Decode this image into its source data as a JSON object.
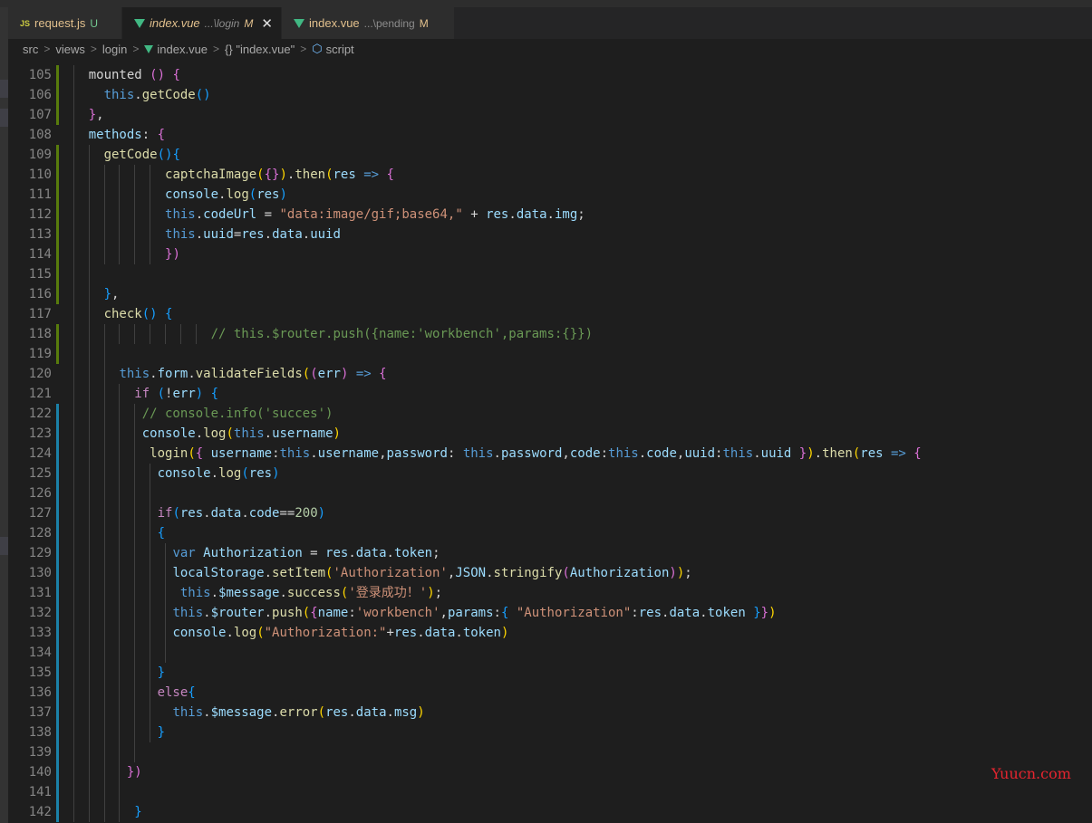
{
  "tabs": [
    {
      "icon": "JS",
      "name": "request.js",
      "path": "",
      "status": "U",
      "active": false
    },
    {
      "icon": "vue",
      "name": "index.vue",
      "path": "...\\login",
      "status": "M",
      "active": true
    },
    {
      "icon": "vue",
      "name": "index.vue",
      "path": "...\\pending",
      "status": "M",
      "active": false
    }
  ],
  "breadcrumb": [
    "src",
    "views",
    "login",
    "index.vue",
    "{} \"index.vue\"",
    "script"
  ],
  "watermark": "Yuucn.com",
  "lines": [
    {
      "n": "105",
      "g": "#587c0c",
      "x": [
        [
          "    ",
          "p"
        ],
        [
          "mounted",
          "p"
        ],
        [
          " ",
          "p"
        ],
        [
          "()",
          "b2"
        ],
        [
          " ",
          "p"
        ],
        [
          "{",
          "b2"
        ]
      ]
    },
    {
      "n": "106",
      "g": "#587c0c",
      "x": [
        [
          "      ",
          "p"
        ],
        [
          "this",
          "k"
        ],
        [
          ".",
          "p"
        ],
        [
          "getCode",
          "f"
        ],
        [
          "()",
          "b3"
        ]
      ]
    },
    {
      "n": "107",
      "g": "#587c0c",
      "x": [
        [
          "    ",
          "p"
        ],
        [
          "}",
          "b2"
        ],
        [
          ",",
          "p"
        ]
      ]
    },
    {
      "n": "108",
      "g": "",
      "x": [
        [
          "    ",
          "p"
        ],
        [
          "methods",
          "v"
        ],
        [
          ": ",
          "p"
        ],
        [
          "{",
          "b2"
        ]
      ]
    },
    {
      "n": "109",
      "g": "#587c0c",
      "x": [
        [
          "      ",
          "p"
        ],
        [
          "getCode",
          "f"
        ],
        [
          "()",
          "b3"
        ],
        [
          "{",
          "b3"
        ]
      ]
    },
    {
      "n": "110",
      "g": "#587c0c",
      "x": [
        [
          "              ",
          "p"
        ],
        [
          "captchaImage",
          "f"
        ],
        [
          "(",
          "b1"
        ],
        [
          "{}",
          "b2"
        ],
        [
          ")",
          "b1"
        ],
        [
          ".",
          "p"
        ],
        [
          "then",
          "f"
        ],
        [
          "(",
          "b1"
        ],
        [
          "res",
          "v"
        ],
        [
          " ",
          "p"
        ],
        [
          "=>",
          "k"
        ],
        [
          " ",
          "p"
        ],
        [
          "{",
          "b2"
        ]
      ]
    },
    {
      "n": "111",
      "g": "#587c0c",
      "x": [
        [
          "              ",
          "p"
        ],
        [
          "console",
          "v"
        ],
        [
          ".",
          "p"
        ],
        [
          "log",
          "f"
        ],
        [
          "(",
          "b3"
        ],
        [
          "res",
          "v"
        ],
        [
          ")",
          "b3"
        ]
      ]
    },
    {
      "n": "112",
      "g": "#587c0c",
      "x": [
        [
          "              ",
          "p"
        ],
        [
          "this",
          "k"
        ],
        [
          ".",
          "p"
        ],
        [
          "codeUrl",
          "v"
        ],
        [
          " = ",
          "p"
        ],
        [
          "\"data:image/gif;base64,\"",
          "s"
        ],
        [
          " + ",
          "p"
        ],
        [
          "res",
          "v"
        ],
        [
          ".",
          "p"
        ],
        [
          "data",
          "v"
        ],
        [
          ".",
          "p"
        ],
        [
          "img",
          "v"
        ],
        [
          ";",
          "p"
        ]
      ]
    },
    {
      "n": "113",
      "g": "#587c0c",
      "x": [
        [
          "              ",
          "p"
        ],
        [
          "this",
          "k"
        ],
        [
          ".",
          "p"
        ],
        [
          "uuid",
          "v"
        ],
        [
          "=",
          "p"
        ],
        [
          "res",
          "v"
        ],
        [
          ".",
          "p"
        ],
        [
          "data",
          "v"
        ],
        [
          ".",
          "p"
        ],
        [
          "uuid",
          "v"
        ]
      ]
    },
    {
      "n": "114",
      "g": "#587c0c",
      "x": [
        [
          "              ",
          "p"
        ],
        [
          "})",
          "b2"
        ]
      ]
    },
    {
      "n": "115",
      "g": "#587c0c",
      "x": []
    },
    {
      "n": "116",
      "g": "#587c0c",
      "x": [
        [
          "      ",
          "p"
        ],
        [
          "}",
          "b3"
        ],
        [
          ",",
          "p"
        ]
      ]
    },
    {
      "n": "117",
      "g": "",
      "x": [
        [
          "      ",
          "p"
        ],
        [
          "check",
          "f"
        ],
        [
          "()",
          "b3"
        ],
        [
          " ",
          "p"
        ],
        [
          "{",
          "b3"
        ]
      ]
    },
    {
      "n": "118",
      "g": "#587c0c",
      "x": [
        [
          "                    ",
          "p"
        ],
        [
          "// this.$router.push({name:'workbench',params:{}})",
          "c"
        ]
      ]
    },
    {
      "n": "119",
      "g": "#587c0c",
      "x": []
    },
    {
      "n": "120",
      "g": "",
      "x": [
        [
          "        ",
          "p"
        ],
        [
          "this",
          "k"
        ],
        [
          ".",
          "p"
        ],
        [
          "form",
          "v"
        ],
        [
          ".",
          "p"
        ],
        [
          "validateFields",
          "f"
        ],
        [
          "(",
          "b1"
        ],
        [
          "(",
          "b2"
        ],
        [
          "err",
          "v"
        ],
        [
          ")",
          "b2"
        ],
        [
          " ",
          "p"
        ],
        [
          "=>",
          "k"
        ],
        [
          " ",
          "p"
        ],
        [
          "{",
          "b2"
        ]
      ]
    },
    {
      "n": "121",
      "g": "",
      "x": [
        [
          "          ",
          "p"
        ],
        [
          "if",
          "kc"
        ],
        [
          " ",
          "p"
        ],
        [
          "(",
          "b3"
        ],
        [
          "!",
          "p"
        ],
        [
          "err",
          "v"
        ],
        [
          ")",
          "b3"
        ],
        [
          " ",
          "p"
        ],
        [
          "{",
          "b3"
        ]
      ]
    },
    {
      "n": "122",
      "g": "#1b81a8",
      "x": [
        [
          "           ",
          "p"
        ],
        [
          "// console.info('succes')",
          "c"
        ]
      ]
    },
    {
      "n": "123",
      "g": "#1b81a8",
      "x": [
        [
          "           ",
          "p"
        ],
        [
          "console",
          "v"
        ],
        [
          ".",
          "p"
        ],
        [
          "log",
          "f"
        ],
        [
          "(",
          "b1"
        ],
        [
          "this",
          "k"
        ],
        [
          ".",
          "p"
        ],
        [
          "username",
          "v"
        ],
        [
          ")",
          "b1"
        ]
      ]
    },
    {
      "n": "124",
      "g": "#1b81a8",
      "x": [
        [
          "            ",
          "p"
        ],
        [
          "login",
          "f"
        ],
        [
          "(",
          "b1"
        ],
        [
          "{",
          "b2"
        ],
        [
          " ",
          "p"
        ],
        [
          "username",
          "v"
        ],
        [
          ":",
          "p"
        ],
        [
          "this",
          "k"
        ],
        [
          ".",
          "p"
        ],
        [
          "username",
          "v"
        ],
        [
          ",",
          "p"
        ],
        [
          "password",
          "v"
        ],
        [
          ": ",
          "p"
        ],
        [
          "this",
          "k"
        ],
        [
          ".",
          "p"
        ],
        [
          "password",
          "v"
        ],
        [
          ",",
          "p"
        ],
        [
          "code",
          "v"
        ],
        [
          ":",
          "p"
        ],
        [
          "this",
          "k"
        ],
        [
          ".",
          "p"
        ],
        [
          "code",
          "v"
        ],
        [
          ",",
          "p"
        ],
        [
          "uuid",
          "v"
        ],
        [
          ":",
          "p"
        ],
        [
          "this",
          "k"
        ],
        [
          ".",
          "p"
        ],
        [
          "uuid",
          "v"
        ],
        [
          " ",
          "p"
        ],
        [
          "}",
          "b2"
        ],
        [
          ")",
          "b1"
        ],
        [
          ".",
          "p"
        ],
        [
          "then",
          "f"
        ],
        [
          "(",
          "b1"
        ],
        [
          "res",
          "v"
        ],
        [
          " ",
          "p"
        ],
        [
          "=>",
          "k"
        ],
        [
          " ",
          "p"
        ],
        [
          "{",
          "b2"
        ]
      ]
    },
    {
      "n": "125",
      "g": "#1b81a8",
      "x": [
        [
          "             ",
          "p"
        ],
        [
          "console",
          "v"
        ],
        [
          ".",
          "p"
        ],
        [
          "log",
          "f"
        ],
        [
          "(",
          "b3"
        ],
        [
          "res",
          "v"
        ],
        [
          ")",
          "b3"
        ]
      ]
    },
    {
      "n": "126",
      "g": "#1b81a8",
      "x": []
    },
    {
      "n": "127",
      "g": "#1b81a8",
      "x": [
        [
          "             ",
          "p"
        ],
        [
          "if",
          "kc"
        ],
        [
          "(",
          "b3"
        ],
        [
          "res",
          "v"
        ],
        [
          ".",
          "p"
        ],
        [
          "data",
          "v"
        ],
        [
          ".",
          "p"
        ],
        [
          "code",
          "v"
        ],
        [
          "==",
          "p"
        ],
        [
          "200",
          "n"
        ],
        [
          ")",
          "b3"
        ]
      ]
    },
    {
      "n": "128",
      "g": "#1b81a8",
      "x": [
        [
          "             ",
          "p"
        ],
        [
          "{",
          "b3"
        ]
      ]
    },
    {
      "n": "129",
      "g": "#1b81a8",
      "x": [
        [
          "               ",
          "p"
        ],
        [
          "var",
          "k"
        ],
        [
          " ",
          "p"
        ],
        [
          "Authorization",
          "v"
        ],
        [
          " = ",
          "p"
        ],
        [
          "res",
          "v"
        ],
        [
          ".",
          "p"
        ],
        [
          "data",
          "v"
        ],
        [
          ".",
          "p"
        ],
        [
          "token",
          "v"
        ],
        [
          ";",
          "p"
        ]
      ]
    },
    {
      "n": "130",
      "g": "#1b81a8",
      "x": [
        [
          "               ",
          "p"
        ],
        [
          "localStorage",
          "v"
        ],
        [
          ".",
          "p"
        ],
        [
          "setItem",
          "f"
        ],
        [
          "(",
          "b1"
        ],
        [
          "'Authorization'",
          "s"
        ],
        [
          ",",
          "p"
        ],
        [
          "JSON",
          "v"
        ],
        [
          ".",
          "p"
        ],
        [
          "stringify",
          "f"
        ],
        [
          "(",
          "b2"
        ],
        [
          "Authorization",
          "v"
        ],
        [
          ")",
          "b2"
        ],
        [
          ")",
          "b1"
        ],
        [
          ";",
          "p"
        ]
      ]
    },
    {
      "n": "131",
      "g": "#1b81a8",
      "x": [
        [
          "                ",
          "p"
        ],
        [
          "this",
          "k"
        ],
        [
          ".",
          "p"
        ],
        [
          "$message",
          "v"
        ],
        [
          ".",
          "p"
        ],
        [
          "success",
          "f"
        ],
        [
          "(",
          "b1"
        ],
        [
          "'登录成功！'",
          "s"
        ],
        [
          ")",
          "b1"
        ],
        [
          ";",
          "p"
        ]
      ]
    },
    {
      "n": "132",
      "g": "#1b81a8",
      "x": [
        [
          "               ",
          "p"
        ],
        [
          "this",
          "k"
        ],
        [
          ".",
          "p"
        ],
        [
          "$router",
          "v"
        ],
        [
          ".",
          "p"
        ],
        [
          "push",
          "f"
        ],
        [
          "(",
          "b1"
        ],
        [
          "{",
          "b2"
        ],
        [
          "name",
          "v"
        ],
        [
          ":",
          "p"
        ],
        [
          "'workbench'",
          "s"
        ],
        [
          ",",
          "p"
        ],
        [
          "params",
          "v"
        ],
        [
          ":",
          "p"
        ],
        [
          "{",
          "b3"
        ],
        [
          " ",
          "p"
        ],
        [
          "\"Authorization\"",
          "s"
        ],
        [
          ":",
          "p"
        ],
        [
          "res",
          "v"
        ],
        [
          ".",
          "p"
        ],
        [
          "data",
          "v"
        ],
        [
          ".",
          "p"
        ],
        [
          "token",
          "v"
        ],
        [
          " ",
          "p"
        ],
        [
          "}",
          "b3"
        ],
        [
          "}",
          "b2"
        ],
        [
          ")",
          "b1"
        ]
      ]
    },
    {
      "n": "133",
      "g": "#1b81a8",
      "x": [
        [
          "               ",
          "p"
        ],
        [
          "console",
          "v"
        ],
        [
          ".",
          "p"
        ],
        [
          "log",
          "f"
        ],
        [
          "(",
          "b1"
        ],
        [
          "\"Authorization:\"",
          "s"
        ],
        [
          "+",
          "p"
        ],
        [
          "res",
          "v"
        ],
        [
          ".",
          "p"
        ],
        [
          "data",
          "v"
        ],
        [
          ".",
          "p"
        ],
        [
          "token",
          "v"
        ],
        [
          ")",
          "b1"
        ]
      ]
    },
    {
      "n": "134",
      "g": "#1b81a8",
      "x": []
    },
    {
      "n": "135",
      "g": "#1b81a8",
      "x": [
        [
          "             ",
          "p"
        ],
        [
          "}",
          "b3"
        ]
      ]
    },
    {
      "n": "136",
      "g": "#1b81a8",
      "x": [
        [
          "             ",
          "p"
        ],
        [
          "else",
          "kc"
        ],
        [
          "{",
          "b3"
        ]
      ]
    },
    {
      "n": "137",
      "g": "#1b81a8",
      "x": [
        [
          "               ",
          "p"
        ],
        [
          "this",
          "k"
        ],
        [
          ".",
          "p"
        ],
        [
          "$message",
          "v"
        ],
        [
          ".",
          "p"
        ],
        [
          "error",
          "f"
        ],
        [
          "(",
          "b1"
        ],
        [
          "res",
          "v"
        ],
        [
          ".",
          "p"
        ],
        [
          "data",
          "v"
        ],
        [
          ".",
          "p"
        ],
        [
          "msg",
          "v"
        ],
        [
          ")",
          "b1"
        ]
      ]
    },
    {
      "n": "138",
      "g": "#1b81a8",
      "x": [
        [
          "             ",
          "p"
        ],
        [
          "}",
          "b3"
        ]
      ]
    },
    {
      "n": "139",
      "g": "#1b81a8",
      "x": []
    },
    {
      "n": "140",
      "g": "#1b81a8",
      "x": [
        [
          "         ",
          "p"
        ],
        [
          "})",
          "b2"
        ]
      ]
    },
    {
      "n": "141",
      "g": "#1b81a8",
      "x": []
    },
    {
      "n": "142",
      "g": "#1b81a8",
      "x": [
        [
          "          ",
          "p"
        ],
        [
          "}",
          "b3"
        ]
      ]
    }
  ]
}
